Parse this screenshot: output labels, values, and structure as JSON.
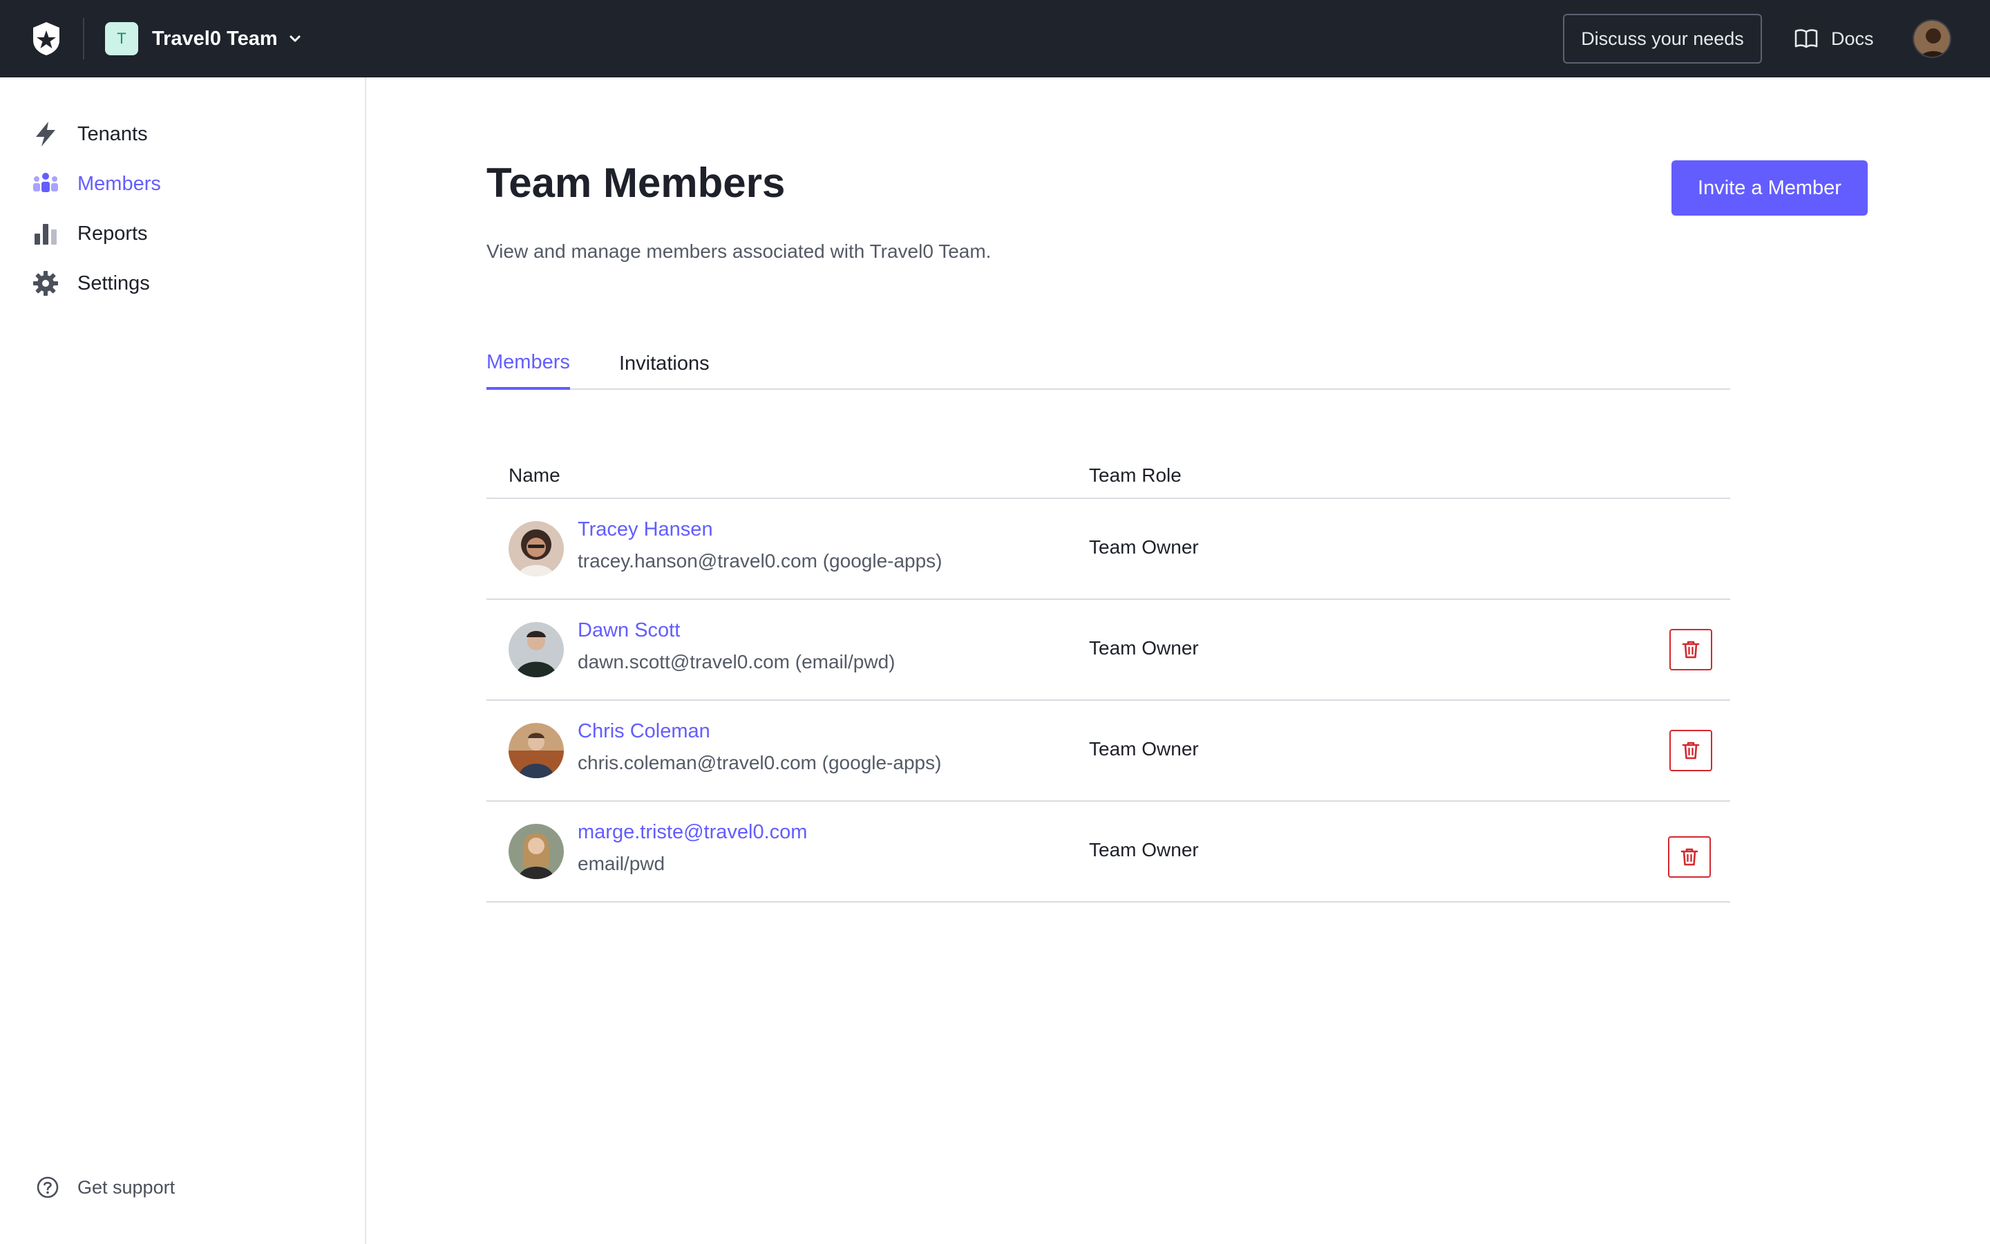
{
  "header": {
    "team_initial": "T",
    "team_name": "Travel0 Team",
    "discuss_label": "Discuss your needs",
    "docs_label": "Docs"
  },
  "sidebar": {
    "items": [
      {
        "label": "Tenants",
        "icon": "lightning-icon",
        "active": false
      },
      {
        "label": "Members",
        "icon": "members-icon",
        "active": true
      },
      {
        "label": "Reports",
        "icon": "bar-chart-icon",
        "active": false
      },
      {
        "label": "Settings",
        "icon": "gear-icon",
        "active": false
      }
    ],
    "support_label": "Get support"
  },
  "main": {
    "title": "Team Members",
    "subtitle": "View and manage members associated with Travel0 Team.",
    "invite_label": "Invite a Member",
    "tabs": [
      {
        "label": "Members",
        "active": true
      },
      {
        "label": "Invitations",
        "active": false
      }
    ],
    "table": {
      "columns": [
        "Name",
        "Team Role"
      ],
      "rows": [
        {
          "name": "Tracey Hansen",
          "email": "tracey.hanson@travel0.com (google-apps)",
          "role": "Team Owner",
          "deletable": false
        },
        {
          "name": "Dawn Scott",
          "email": "dawn.scott@travel0.com (email/pwd)",
          "role": "Team Owner",
          "deletable": true
        },
        {
          "name": "Chris Coleman",
          "email": "chris.coleman@travel0.com (google-apps)",
          "role": "Team Owner",
          "deletable": true
        },
        {
          "name": "marge.triste@travel0.com",
          "email": "email/pwd",
          "role": "Team Owner",
          "deletable": true
        }
      ]
    }
  },
  "colors": {
    "accent": "#635dff",
    "topbar": "#1f232b",
    "danger": "#d4282f"
  }
}
